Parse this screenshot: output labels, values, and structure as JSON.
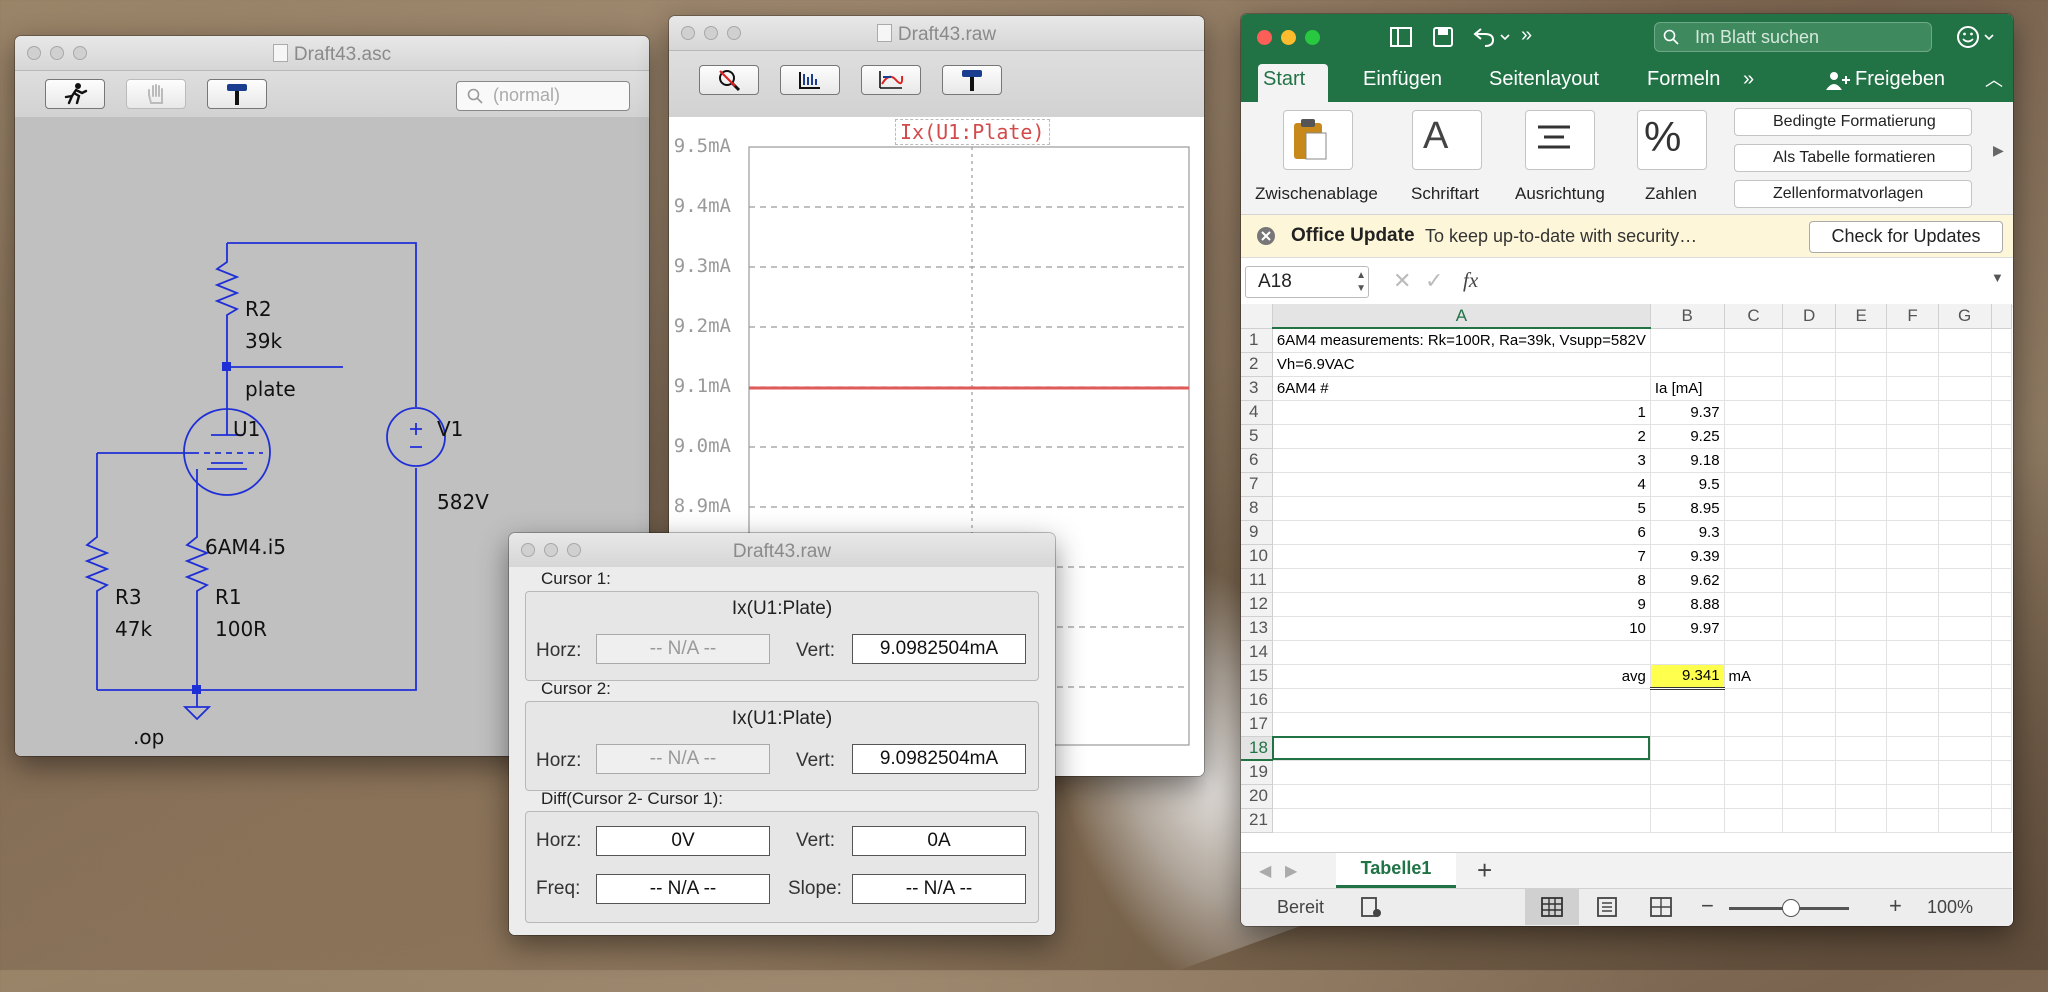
{
  "schematic": {
    "title": "Draft43.asc",
    "search_placeholder": "(normal)",
    "labels": {
      "r2_name": "R2",
      "r2_value": "39k",
      "node_plate": "plate",
      "u1_name": "U1",
      "u1_model": "6AM4.i5",
      "v1_name": "V1",
      "v1_value": "582V",
      "r3_name": "R3",
      "r3_value": "47k",
      "r1_name": "R1",
      "r1_value": "100R",
      "directive": ".op"
    }
  },
  "waveform": {
    "title": "Draft43.raw",
    "trace_label": "Ix(U1:Plate)",
    "trace_value_mA": 9.0982504,
    "y_ticks": [
      "9.5mA",
      "9.4mA",
      "9.3mA",
      "9.2mA",
      "9.1mA",
      "9.0mA",
      "8.9mA"
    ],
    "trace_color": "#e05a5a"
  },
  "cursor_dialog": {
    "title": "Draft43.raw",
    "cursor1": {
      "label": "Cursor 1:",
      "trace": "Ix(U1:Plate)",
      "horz_label": "Horz:",
      "horz": "-- N/A --",
      "vert_label": "Vert:",
      "vert": "9.0982504mA"
    },
    "cursor2": {
      "label": "Cursor 2:",
      "trace": "Ix(U1:Plate)",
      "horz_label": "Horz:",
      "horz": "-- N/A --",
      "vert_label": "Vert:",
      "vert": "9.0982504mA"
    },
    "diff": {
      "label": "Diff(Cursor 2- Cursor 1):",
      "horz_label": "Horz:",
      "horz": "0V",
      "vert_label": "Vert:",
      "vert": "0A",
      "freq_label": "Freq:",
      "freq": "-- N/A --",
      "slope_label": "Slope:",
      "slope": "-- N/A --"
    }
  },
  "excel": {
    "search_placeholder": "Im Blatt suchen",
    "tabs": [
      "Start",
      "Einfügen",
      "Seitenlayout",
      "Formeln"
    ],
    "share_label": "Freigeben",
    "ribbon": {
      "clipboard": "Zwischenablage",
      "font": "Schriftart",
      "alignment": "Ausrichtung",
      "number": "Zahlen",
      "cond_format": "Bedingte Formatierung",
      "as_table": "Als Tabelle formatieren",
      "cell_styles": "Zellenformatvorlagen"
    },
    "update_bar": {
      "title": "Office Update",
      "message": "To keep up-to-date with security…",
      "button": "Check for Updates"
    },
    "name_box": "A18",
    "fx_label": "fx",
    "columns": [
      "A",
      "B",
      "C",
      "D",
      "E",
      "F",
      "G"
    ],
    "rows": [
      {
        "n": "1",
        "a": "6AM4 measurements: Rk=100R, Ra=39k, Vsupp=582V",
        "b": "",
        "c": ""
      },
      {
        "n": "2",
        "a": "Vh=6.9VAC",
        "b": "",
        "c": ""
      },
      {
        "n": "3",
        "a": "6AM4 #",
        "b": "Ia [mA]",
        "c": ""
      },
      {
        "n": "4",
        "a": "1",
        "b": "9.37",
        "c": ""
      },
      {
        "n": "5",
        "a": "2",
        "b": "9.25",
        "c": ""
      },
      {
        "n": "6",
        "a": "3",
        "b": "9.18",
        "c": ""
      },
      {
        "n": "7",
        "a": "4",
        "b": "9.5",
        "c": ""
      },
      {
        "n": "8",
        "a": "5",
        "b": "8.95",
        "c": ""
      },
      {
        "n": "9",
        "a": "6",
        "b": "9.3",
        "c": ""
      },
      {
        "n": "10",
        "a": "7",
        "b": "9.39",
        "c": ""
      },
      {
        "n": "11",
        "a": "8",
        "b": "9.62",
        "c": ""
      },
      {
        "n": "12",
        "a": "9",
        "b": "8.88",
        "c": ""
      },
      {
        "n": "13",
        "a": "10",
        "b": "9.97",
        "c": ""
      },
      {
        "n": "14",
        "a": "",
        "b": "",
        "c": ""
      },
      {
        "n": "15",
        "a": "avg",
        "b": "9.341",
        "c": "mA"
      },
      {
        "n": "16",
        "a": "",
        "b": "",
        "c": ""
      },
      {
        "n": "17",
        "a": "",
        "b": "",
        "c": ""
      },
      {
        "n": "18",
        "a": "",
        "b": "",
        "c": ""
      },
      {
        "n": "19",
        "a": "",
        "b": "",
        "c": ""
      },
      {
        "n": "20",
        "a": "",
        "b": "",
        "c": ""
      },
      {
        "n": "21",
        "a": "",
        "b": "",
        "c": ""
      }
    ],
    "sheet_tab": "Tabelle1",
    "status": "Bereit",
    "zoom": "100%",
    "accent": "#217346",
    "highlight": "#ffff4d"
  }
}
